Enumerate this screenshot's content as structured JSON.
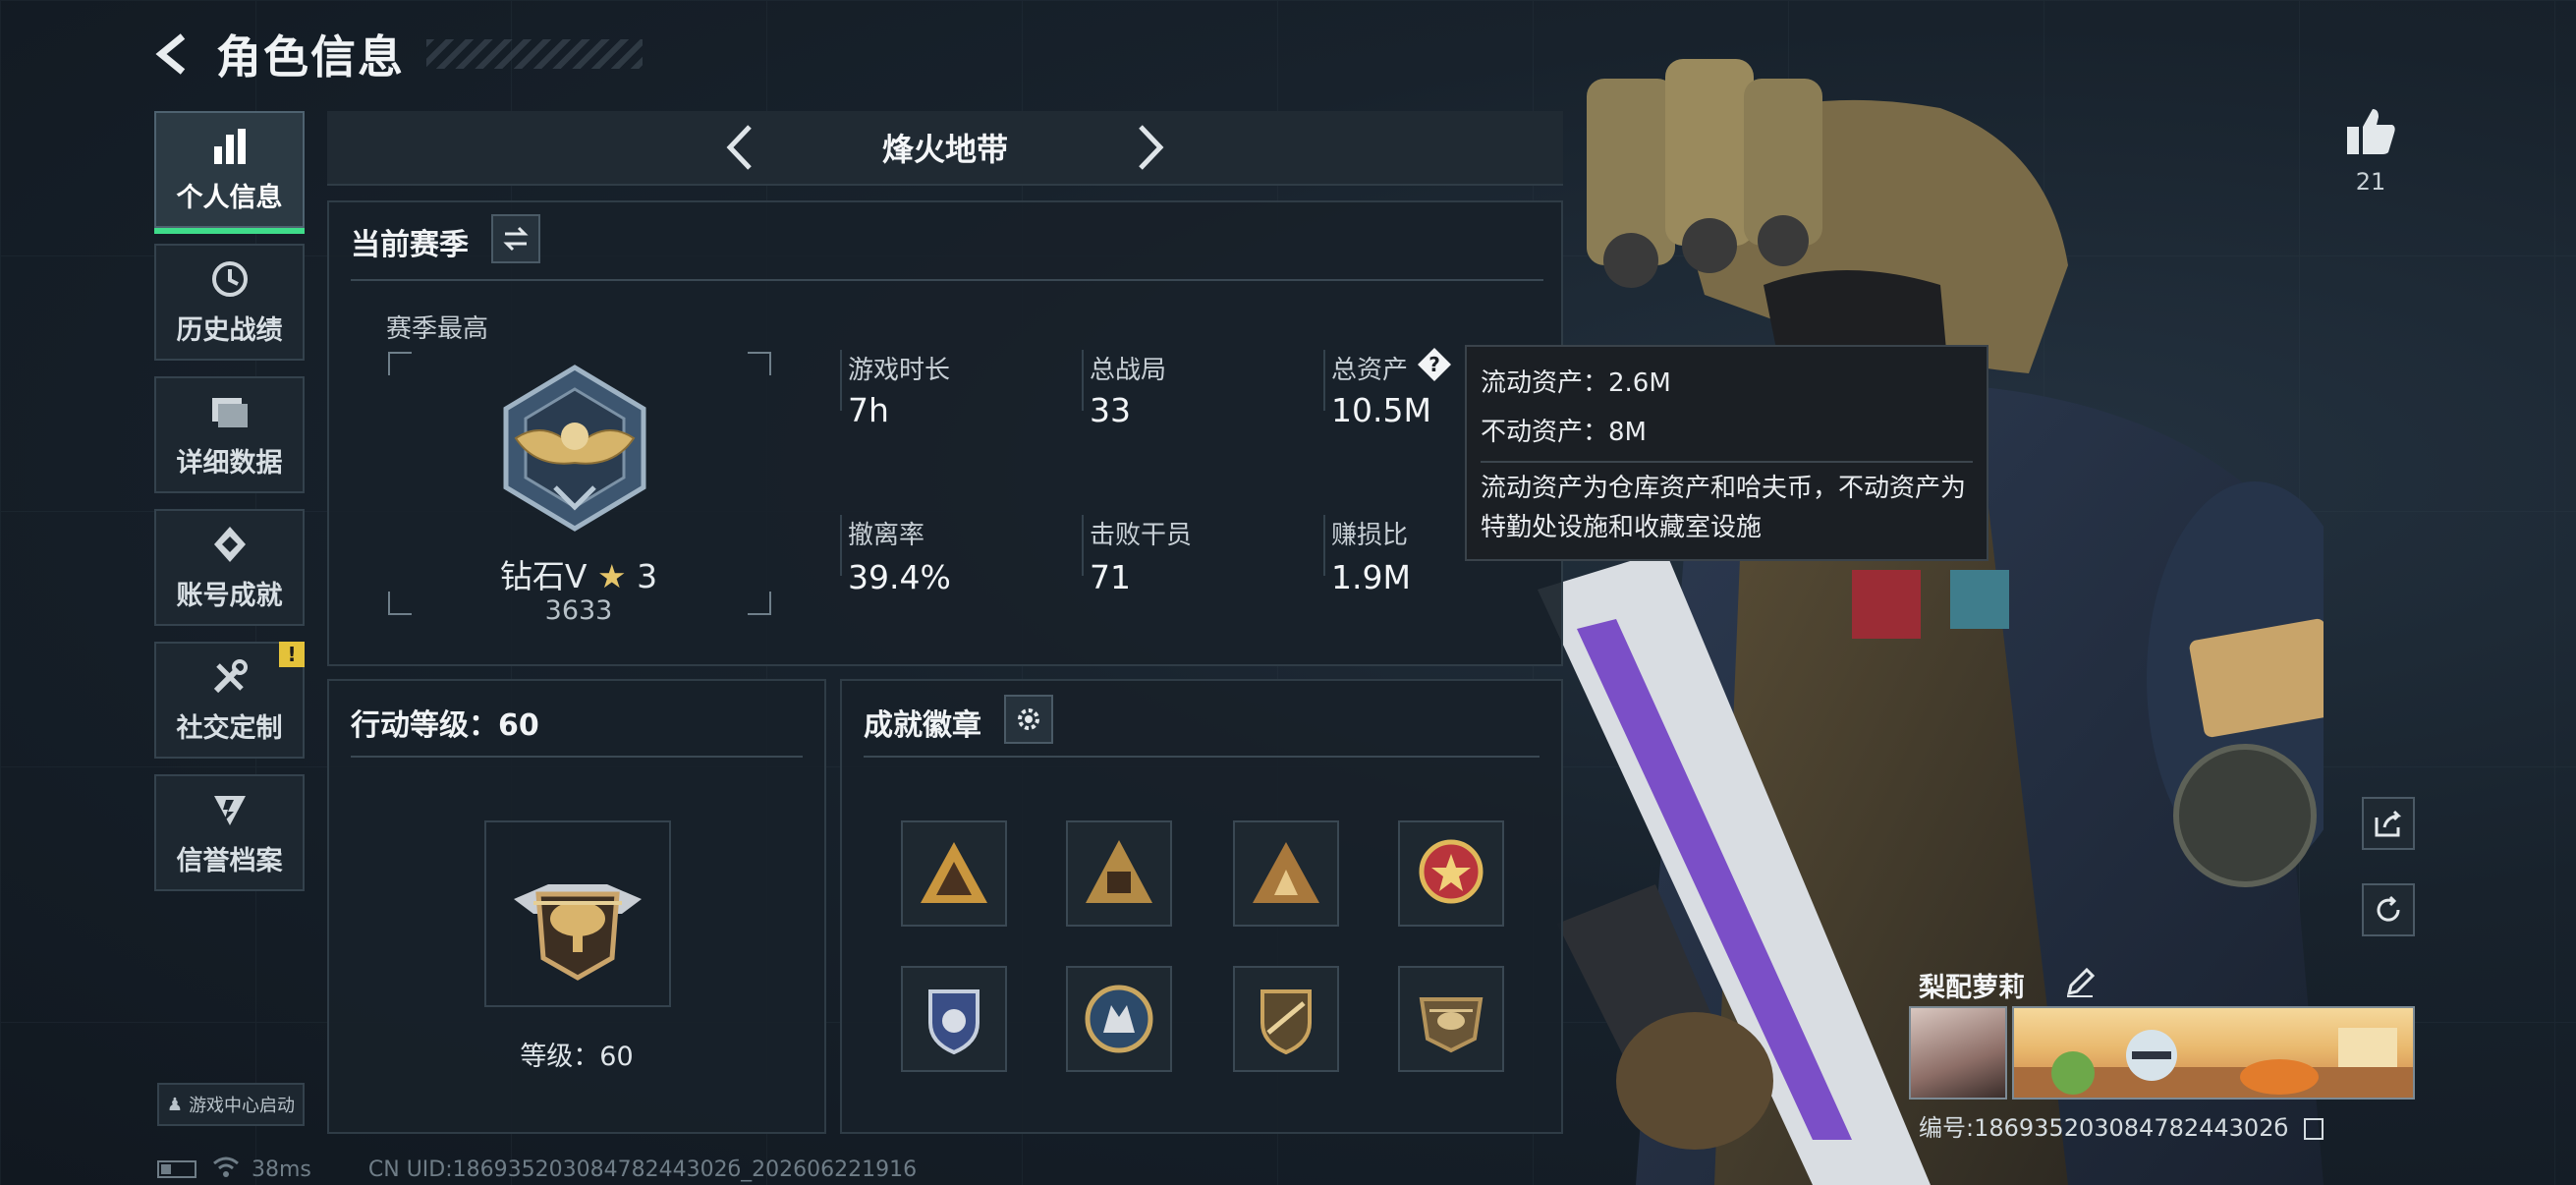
{
  "header": {
    "title": "角色信息"
  },
  "sidebar": {
    "items": [
      {
        "label": "个人信息",
        "icon": "bar-chart-icon"
      },
      {
        "label": "历史战绩",
        "icon": "history-clock-icon"
      },
      {
        "label": "详细数据",
        "icon": "folder-icon"
      },
      {
        "label": "账号成就",
        "icon": "achievement-icon"
      },
      {
        "label": "社交定制",
        "icon": "tools-icon",
        "badge": "!"
      },
      {
        "label": "信誉档案",
        "icon": "credit-shield-icon"
      }
    ],
    "game_center": "游戏中心启动"
  },
  "mode": {
    "title": "烽火地带"
  },
  "season": {
    "title": "当前赛季",
    "best_label": "赛季最高",
    "rank_name": "钻石V",
    "rank_stars": "3",
    "rank_points": "3633",
    "stats": {
      "play_time": {
        "label": "游戏时长",
        "value": "7h"
      },
      "total_matches": {
        "label": "总战局",
        "value": "33"
      },
      "total_assets": {
        "label": "总资产",
        "value": "10.5M"
      },
      "extract_rate": {
        "label": "撤离率",
        "value": "39.4%"
      },
      "kills": {
        "label": "击败干员",
        "value": "71"
      },
      "profit_ratio": {
        "label": "赚损比",
        "value": "1.9M"
      }
    }
  },
  "tooltip": {
    "liquid": "流动资产：2.6M",
    "fixed": "不动资产：8M",
    "desc": "流动资产为仓库资产和哈夫币，不动资产为特勤处设施和收藏室设施"
  },
  "action": {
    "title": "行动等级：60",
    "level_text": "等级：60"
  },
  "badges": {
    "title": "成就徽章"
  },
  "right": {
    "like_count": "21",
    "player_name": "梨配萝莉",
    "player_id": "编号:18693520308478244302б"
  },
  "status": {
    "ping": "38ms",
    "uid": "CN UID:18693520308478244302б_202606221916"
  },
  "colors": {
    "accent": "#3fdc8a",
    "warning": "#e4c23a",
    "panel": "#182129"
  }
}
